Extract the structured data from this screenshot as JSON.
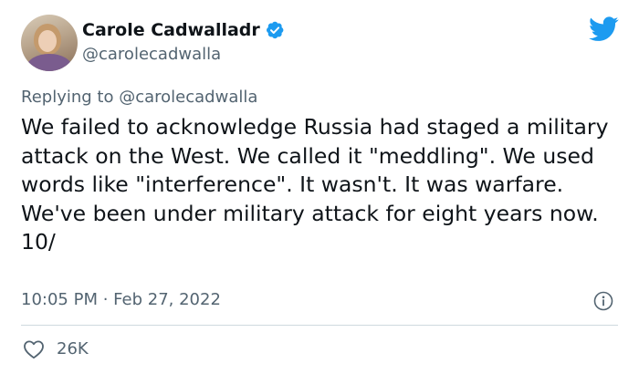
{
  "author": {
    "display_name": "Carole Cadwalladr",
    "handle": "@carolecadwalla",
    "verified": true,
    "avatar_icon": "profile-photo"
  },
  "platform_icon": "twitter-bird-icon",
  "reply": {
    "prefix": "Replying to",
    "mention": "@carolecadwalla"
  },
  "tweet": {
    "text": "We failed to acknowledge Russia had staged a military attack on the West. We called it \"meddling\". We used words like \"interference\". It wasn't. It was warfare. We've been under military attack for eight years now.\n10/",
    "timestamp": "10:05 PM · Feb 27, 2022"
  },
  "actions": {
    "like_count": "26K"
  },
  "colors": {
    "accent": "#1d9bf0",
    "text": "#0f1419",
    "muted": "#536471",
    "divider": "#cfd9de"
  }
}
